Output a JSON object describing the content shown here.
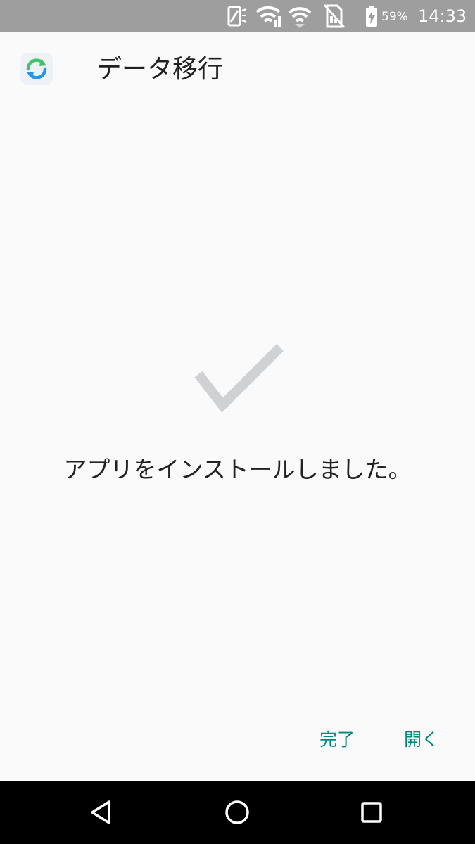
{
  "status_bar": {
    "icons": [
      "screen-rotation-icon",
      "wifi-signal-icon",
      "wifi-icon",
      "no-sim-icon",
      "battery-charging-icon"
    ],
    "battery_percent": "59%",
    "time": "14:33",
    "background_color": "#9e9e9e"
  },
  "app_bar": {
    "app_icon": "sync-icon",
    "title": "データ移行"
  },
  "content": {
    "status_icon": "check-mark-icon",
    "message": "アプリをインストールしました。"
  },
  "actions": {
    "done_label": "完了",
    "open_label": "開く",
    "accent_color": "#00897b"
  },
  "nav_bar": {
    "back": "back-triangle-icon",
    "home": "home-circle-icon",
    "recent": "recent-apps-square-icon"
  }
}
